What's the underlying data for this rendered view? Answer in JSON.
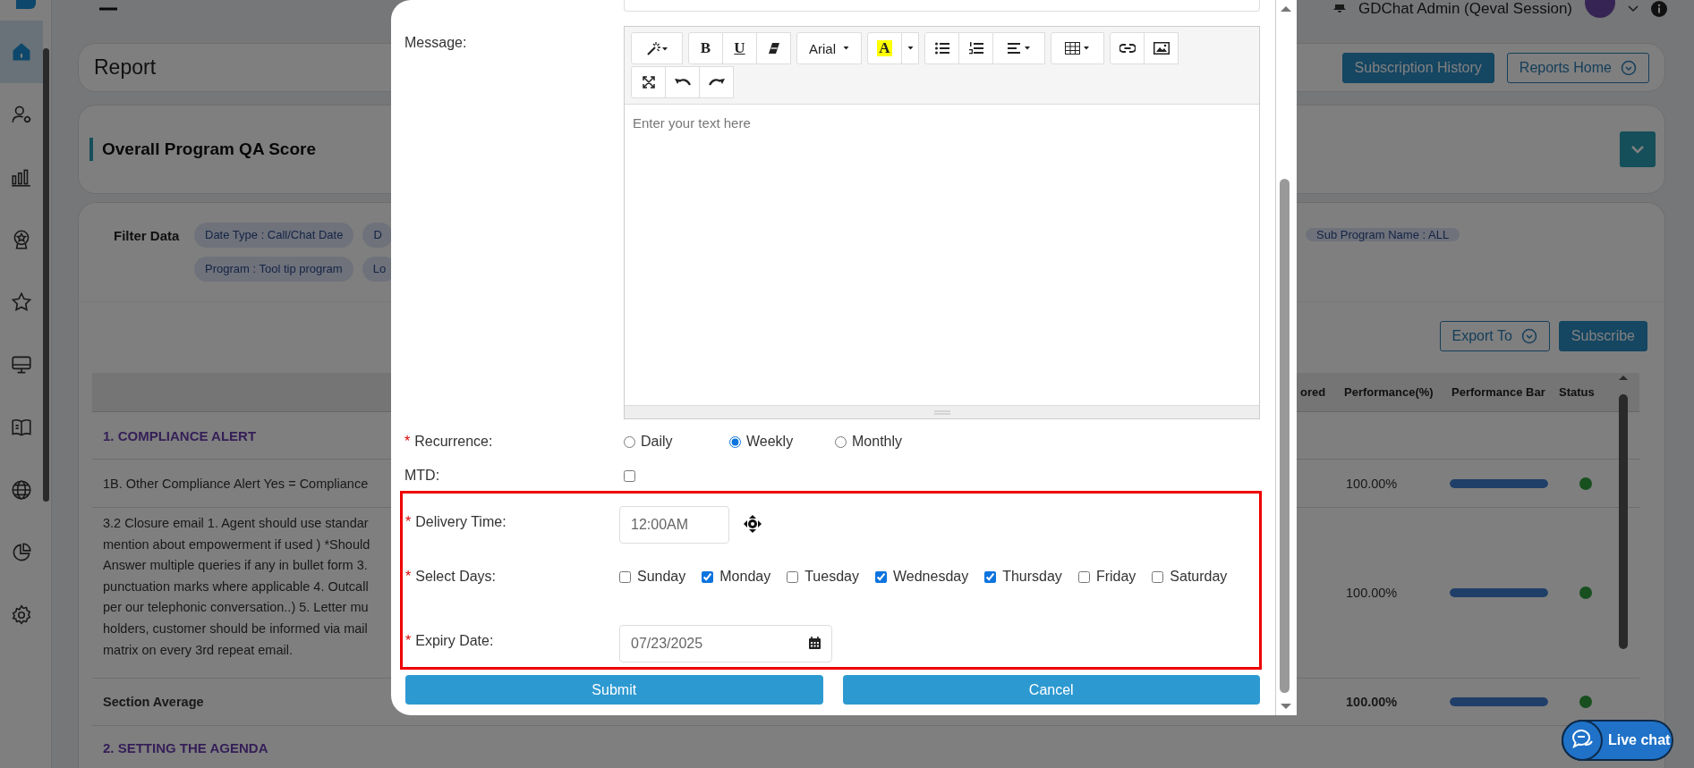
{
  "topbar": {
    "user": "GDChat Admin (Qeval Session)"
  },
  "sidebar": {
    "items": [
      {
        "selected": true
      },
      {
        "selected": false
      },
      {
        "selected": false
      },
      {
        "selected": false
      },
      {
        "selected": false
      },
      {
        "selected": false
      },
      {
        "selected": false
      },
      {
        "selected": false
      },
      {
        "selected": false
      },
      {
        "selected": false
      }
    ]
  },
  "report_header": {
    "title": "Report",
    "buttons": [
      {
        "label": "Subscription History",
        "kind": "primary"
      },
      {
        "label": "Reports Home",
        "kind": "dropdown"
      }
    ]
  },
  "score_card": {
    "title": "Overall Program QA Score",
    "expanded": false
  },
  "filter": {
    "label": "Filter Data",
    "chips": [
      "Date Type : Call/Chat Date",
      "D",
      "Program : Tool tip program",
      "Lo"
    ],
    "right_chips": [
      "Sub Program Name : ALL"
    ]
  },
  "actions": [
    {
      "label": "Export To",
      "kind": "dropdown"
    },
    {
      "label": "Subscribe",
      "kind": "primary"
    }
  ],
  "table": {
    "columns": [
      "ored",
      "Performance(%)",
      "Performance Bar",
      "Status"
    ],
    "rows": [
      {
        "kind": "section",
        "text": "1. COMPLIANCE ALERT"
      },
      {
        "kind": "item",
        "text": "1B. Other Compliance Alert Yes = Compliance",
        "performance": "100.00%",
        "level": 1
      },
      {
        "kind": "item",
        "text": "3.2 Closure email 1. Agent should use standar\nmention about empowerment if used ) *Should\nAnswer multiple queries if any in bullet form 3.\npunctuation marks where applicable 4. Outcall\nper our telephonic conversation..) 5. Letter mu\nholders, customer should be informed via mail\nmatrix on every 3rd repeat email.",
        "performance": "100.00%",
        "level": 1
      },
      {
        "kind": "average",
        "text": "Section Average",
        "performance": "100.00%",
        "level": 1
      },
      {
        "kind": "section",
        "text": "2. SETTING THE AGENDA"
      }
    ]
  },
  "modal": {
    "message": {
      "label": "Message:",
      "placeholder": "Enter your text here",
      "toolbar": [
        [
          [
            {
              "kind": "style"
            }
          ],
          [
            {
              "kind": "bold",
              "label": "B"
            },
            {
              "kind": "underline",
              "label": "U"
            },
            {
              "kind": "eraser"
            }
          ],
          [
            {
              "kind": "font",
              "label": "Arial"
            }
          ],
          [
            {
              "kind": "color",
              "label": "A"
            },
            {
              "kind": "caret"
            }
          ],
          [
            {
              "kind": "bullets"
            },
            {
              "kind": "numbers"
            },
            {
              "kind": "align"
            }
          ],
          [
            {
              "kind": "table"
            }
          ],
          [
            {
              "kind": "link"
            },
            {
              "kind": "image"
            }
          ]
        ],
        [
          [
            {
              "kind": "fullscreen"
            },
            {
              "kind": "undo"
            },
            {
              "kind": "redo"
            }
          ]
        ]
      ]
    },
    "recurrence": {
      "label": "Recurrence:",
      "mark": "*",
      "options": [
        {
          "label": "Daily",
          "selected": false
        },
        {
          "label": "Weekly",
          "selected": true
        },
        {
          "label": "Monthly",
          "selected": false
        }
      ]
    },
    "mtd": {
      "label": "MTD:",
      "checked": false
    },
    "delivery_time": {
      "label": "Delivery Time:",
      "mark": "*",
      "value": "12:00AM"
    },
    "select_days": {
      "label": "Select Days:",
      "mark": "*",
      "days": [
        {
          "label": "Sunday",
          "checked": false
        },
        {
          "label": "Monday",
          "checked": true
        },
        {
          "label": "Tuesday",
          "checked": false
        },
        {
          "label": "Wednesday",
          "checked": true
        },
        {
          "label": "Thursday",
          "checked": true
        },
        {
          "label": "Friday",
          "checked": false
        },
        {
          "label": "Saturday",
          "checked": false
        }
      ]
    },
    "expiry_date": {
      "label": "Expiry Date:",
      "mark": "*",
      "value": "07/23/2025"
    },
    "buttons": [
      {
        "label": "Submit"
      },
      {
        "label": "Cancel"
      }
    ]
  },
  "live_chat": {
    "label": "Live chat"
  }
}
